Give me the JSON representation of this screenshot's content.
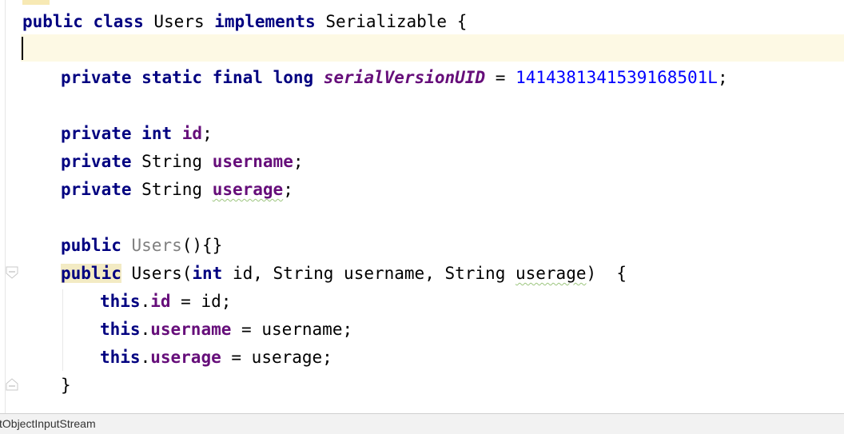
{
  "editor": {
    "lines": {
      "class_decl": {
        "kw_public": "public",
        "kw_class": "class",
        "name": "Users",
        "kw_implements": "implements",
        "iface": "Serializable",
        "brace": "{"
      },
      "serial": {
        "kw_private": "private",
        "kw_static": "static",
        "kw_final": "final",
        "kw_long": "long",
        "field": "serialVersionUID",
        "eq": "=",
        "value": "1414381341539168501L",
        "semi": ";"
      },
      "field_id": {
        "kw_private": "private",
        "type": "int",
        "name": "id",
        "semi": ";"
      },
      "field_username": {
        "kw_private": "private",
        "type": "String",
        "name": "username",
        "semi": ";"
      },
      "field_userage": {
        "kw_private": "private",
        "type": "String",
        "name": "userage",
        "semi": ";"
      },
      "ctor_empty": {
        "kw_public": "public",
        "name": "Users",
        "rest": "(){}"
      },
      "ctor_full": {
        "kw_public": "public",
        "name": "Users",
        "open": "(",
        "t1": "int",
        "p1": " id, String username, String ",
        "p_userage": "userage",
        "close": ")  {"
      },
      "assign_id": {
        "kw_this": "this",
        "dot": ".",
        "field": "id",
        "rest": " = id;"
      },
      "assign_username": {
        "kw_this": "this",
        "dot": ".",
        "field": "username",
        "rest": " = username;"
      },
      "assign_userage": {
        "kw_this": "this",
        "dot": ".",
        "field": "userage",
        "rest": " = userage;"
      },
      "close_brace": "}"
    }
  },
  "statusbar": {
    "text": "ctObjectInputStream"
  },
  "colors": {
    "keyword": "#000080",
    "field": "#660e7a",
    "number": "#0000ff",
    "caret_row": "#fdf9e4",
    "highlight": "#f3ebc4"
  }
}
